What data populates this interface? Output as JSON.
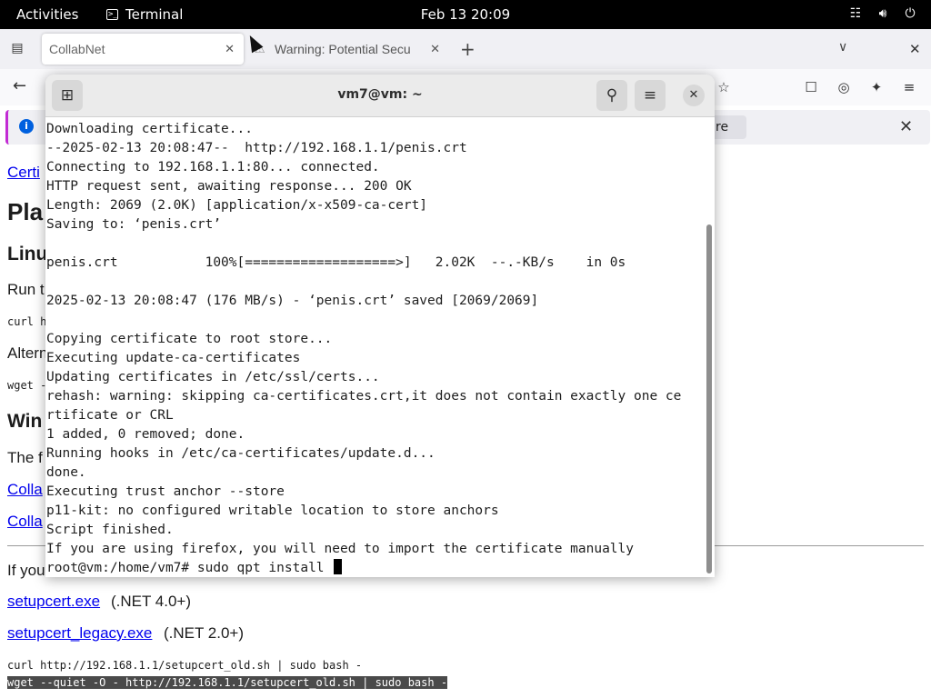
{
  "topbar": {
    "activities": "Activities",
    "app_name": "Terminal",
    "clock": "Feb 13  20:09",
    "tray_icons": [
      "network-icon",
      "volume-icon",
      "power-icon"
    ]
  },
  "browser": {
    "tabs": [
      {
        "label": "CollabNet",
        "active": true
      },
      {
        "label": "Warning: Potential Secu",
        "active": false
      }
    ],
    "notification_button_fragment": "re",
    "page": {
      "link_certs": "Certi",
      "heading_platform": "Pla",
      "heading_linux": "Linu",
      "text_run": "Run t",
      "code_curl_frag": "curl h",
      "text_alt": "Altern",
      "code_wget_frag": "wget -",
      "heading_windows": "Win",
      "text_the": "The f",
      "link_colla1": "Colla",
      "link_colla2": "Colla",
      "text_ifyou": "If you",
      "link_setupcert": "setupcert.exe",
      "setupcert_note": "(.NET 4.0+)",
      "link_setupcert_legacy": "setupcert_legacy.exe",
      "setupcert_legacy_note": "(.NET 2.0+)",
      "code_curl_old": "curl http://192.168.1.1/setupcert_old.sh | sudo bash -",
      "code_wget_old": "wget --quiet -O - http://192.168.1.1/setupcert_old.sh | sudo bash -"
    }
  },
  "terminal": {
    "title": "vm7@vm: ~",
    "lines": [
      "Downloading certificate...",
      "--2025-02-13 20:08:47--  http://192.168.1.1/penis.crt",
      "Connecting to 192.168.1.1:80... connected.",
      "HTTP request sent, awaiting response... 200 OK",
      "Length: 2069 (2.0K) [application/x-x509-ca-cert]",
      "Saving to: ‘penis.crt’",
      "",
      "penis.crt           100%[===================>]   2.02K  --.-KB/s    in 0s",
      "",
      "2025-02-13 20:08:47 (176 MB/s) - ‘penis.crt’ saved [2069/2069]",
      "",
      "Copying certificate to root store...",
      "Executing update-ca-certificates",
      "Updating certificates in /etc/ssl/certs...",
      "rehash: warning: skipping ca-certificates.crt,it does not contain exactly one ce",
      "rtificate or CRL",
      "1 added, 0 removed; done.",
      "Running hooks in /etc/ca-certificates/update.d...",
      "done.",
      "Executing trust anchor --store",
      "p11-kit: no configured writable location to store anchors",
      "Script finished.",
      "If you are using firefox, you will need to import the certificate manually"
    ],
    "prompt": "root@vm:/home/vm7# sudo qpt install "
  }
}
